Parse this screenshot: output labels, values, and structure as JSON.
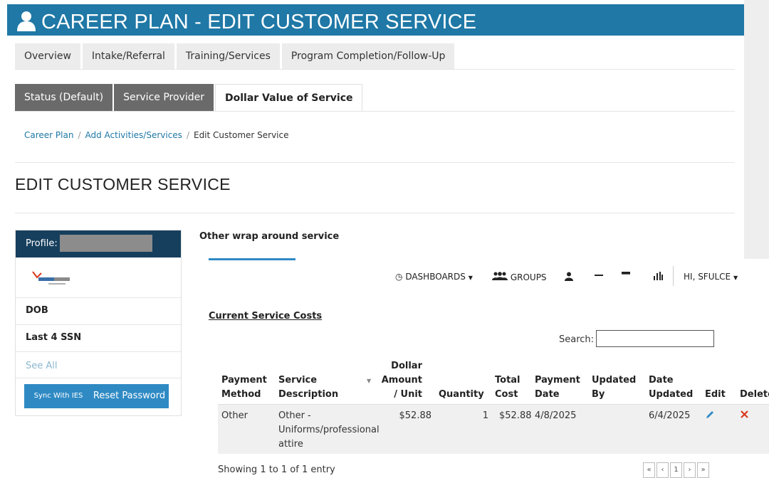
{
  "title_bar": {
    "title": "CAREER PLAN - EDIT CUSTOMER SERVICE",
    "icon": "user-icon",
    "color": "#1f78a6"
  },
  "tabs_primary": [
    "Overview",
    "Intake/Referral",
    "Training/Services",
    "Program Completion/Follow-Up"
  ],
  "tabs_secondary": [
    {
      "label": "Status (Default)",
      "active": false
    },
    {
      "label": "Service Provider",
      "active": false
    },
    {
      "label": "Dollar Value of Service",
      "active": true
    }
  ],
  "breadcrumb": {
    "items": [
      "Career Plan",
      "Add Activities/Services"
    ],
    "separator": "/",
    "current": "Edit Customer Service"
  },
  "page_title": "EDIT CUSTOMER SERVICE",
  "profile": {
    "header_label": "Profile:",
    "dob_label": "DOB",
    "ssn_label": "Last 4 SSN",
    "see_all": "See All",
    "sync_button": "Sync With IES",
    "reset_button": "Reset Password",
    "header_color": "#163f5e"
  },
  "section_heading": "Other wrap around service",
  "topnav": {
    "dashboards": "DASHBOARDS",
    "groups": "GROUPS",
    "greeting": "HI, SFULCE"
  },
  "costs_heading": "Current Service Costs",
  "search": {
    "label": "Search:",
    "value": ""
  },
  "table": {
    "headers": {
      "payment_method": [
        "Payment",
        "Method"
      ],
      "service_description": [
        "Service",
        "Description"
      ],
      "dollar_amount": [
        "Dollar",
        "Amount",
        "/ Unit"
      ],
      "quantity": "Quantity",
      "total_cost": [
        "Total",
        "Cost"
      ],
      "payment_date": [
        "Payment",
        "Date"
      ],
      "updated_by": [
        "Updated",
        "By"
      ],
      "date_updated": [
        "Date",
        "Updated"
      ],
      "edit": "Edit",
      "delete": "Delete"
    },
    "rows": [
      {
        "payment_method": "Other",
        "service_description": [
          "Other -",
          "Uniforms/professional",
          "attire"
        ],
        "dollar_amount": "$52.88",
        "quantity": "1",
        "total_cost": "$52.88",
        "payment_date": "4/8/2025",
        "updated_by": "",
        "date_updated": "6/4/2025"
      }
    ]
  },
  "footer": {
    "showing": "Showing 1 to 1 of 1 entry",
    "pager": [
      "«",
      "‹",
      "1",
      "›",
      "»"
    ]
  },
  "colors": {
    "accent": "#2f8ac4",
    "delete": "#d9381e",
    "tab_dark": "#6a6a6a"
  }
}
